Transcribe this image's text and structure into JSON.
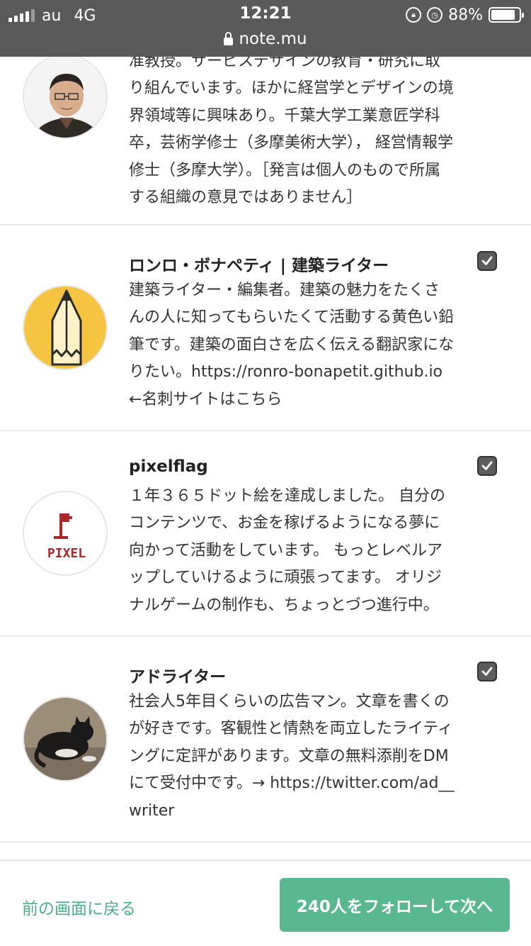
{
  "status_bar": {
    "carrier": "au",
    "network": "4G",
    "time": "12:21",
    "battery_percent": "88%",
    "battery_level": 0.88,
    "url": "note.mu"
  },
  "users": [
    {
      "name": "",
      "desc": "准教授。サービスデザインの教育・研究に取り組んでいます。ほかに経営学とデザインの境界領域等に興味あり。千葉大学工業意匠学科卒，芸術学修士（多摩美術大学）， 経営情報学修士（多摩大学）。［発言は個人のもので所属する組織の意見ではありません］",
      "avatar": "person-photo",
      "checked": false
    },
    {
      "name": "ロンロ・ボナペティ | 建築ライター",
      "desc": "建築ライター・編集者。建築の魅力をたくさんの人に知ってもらいたくて活動する黄色い鉛筆です。建築の面白さを広く伝える翻訳家になりたい。https://ronro-bonapetit.github.io ←名刺サイトはこちら",
      "avatar": "yellow-pencil-logo",
      "checked": true
    },
    {
      "name": "pixelflag",
      "desc": "１年３６５ドット絵を達成しました。 自分のコンテンツで、お金を稼げるようになる夢に向かって活動をしています。 もっとレベルアップしていけるように頑張ってます。 オリジナルゲームの制作も、ちょっとづつ進行中。",
      "avatar": "pixel-flag-logo",
      "avatar_text": "PIXEL",
      "checked": true
    },
    {
      "name": "アドライター",
      "desc": "社会人5年目くらいの広告マン。文章を書くのが好きです。客観性と情熱を両立したライティングに定評があります。文章の無料添削をDMにて受付中です。→ https://twitter.com/ad__writer",
      "avatar": "cat-photo",
      "checked": true
    }
  ],
  "footer": {
    "back_label": "前の画面に戻る",
    "follow_label": "240人をフォローして次へ"
  },
  "colors": {
    "accent": "#5ab890",
    "link": "#4faf87",
    "status_bar": "#5a5a5a"
  }
}
